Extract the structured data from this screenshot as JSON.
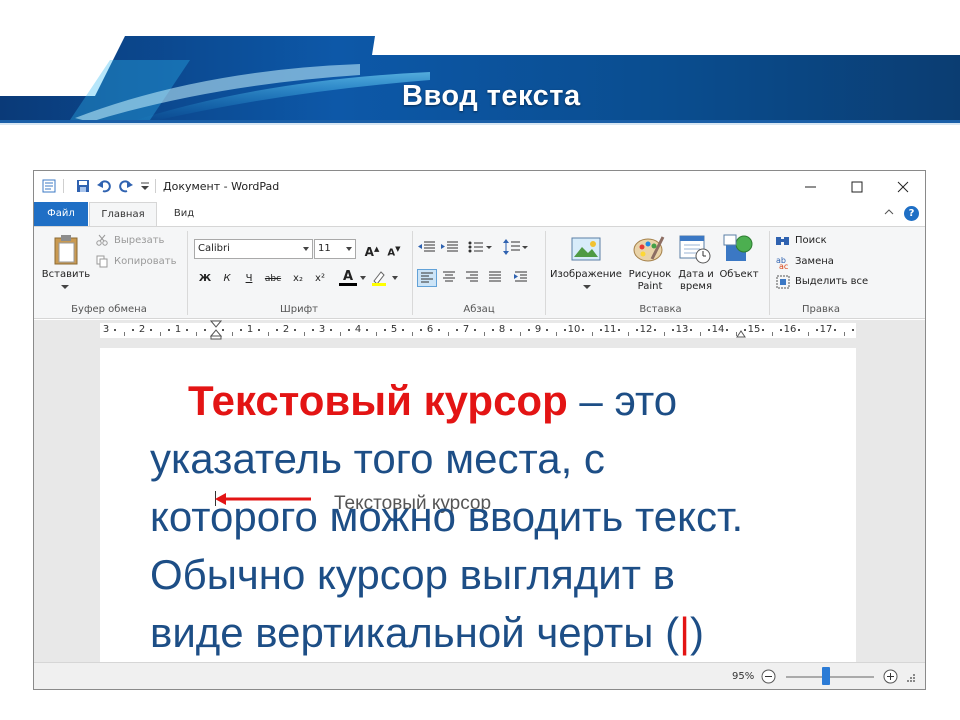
{
  "slide": {
    "title": "Ввод текста"
  },
  "window": {
    "title": "Документ - WordPad",
    "tabs": {
      "file": "Файл",
      "home": "Главная",
      "view": "Вид"
    },
    "help_glyph": "?"
  },
  "ribbon": {
    "clipboard": {
      "paste": "Вставить",
      "cut": "Вырезать",
      "copy": "Копировать",
      "group": "Буфер обмена"
    },
    "font": {
      "family": "Calibri",
      "size": "11",
      "grow_glyph": "A",
      "shrink_glyph": "A",
      "bold": "Ж",
      "italic": "К",
      "underline": "Ч",
      "strike": "abc",
      "subscript": "x₂",
      "superscript": "x²",
      "color_glyph": "A",
      "group": "Шрифт"
    },
    "paragraph": {
      "group": "Абзац"
    },
    "insert": {
      "image": "Изображение",
      "paint_line1": "Рисунок",
      "paint_line2": "Paint",
      "datetime_line1": "Дата и",
      "datetime_line2": "время",
      "object": "Объект",
      "group": "Вставка"
    },
    "editing": {
      "find": "Поиск",
      "replace": "Замена",
      "select_all": "Выделить все",
      "group": "Правка"
    }
  },
  "ruler": {
    "left_labels": [
      "3",
      "2",
      "1"
    ],
    "right_labels": [
      "1",
      "2",
      "3",
      "4",
      "5",
      "6",
      "7",
      "8",
      "9",
      "10",
      "11",
      "12",
      "13",
      "14",
      "15",
      "16",
      "17"
    ]
  },
  "document": {
    "cursor_label": "Текстовый курсор"
  },
  "statusbar": {
    "zoom": "95%",
    "zoom_fraction": 0.45
  },
  "body": {
    "term": "Текстовый курсор",
    "line1_rest": " – это",
    "line2": "указатель того места, с",
    "line3": "которого можно вводить текст.",
    "line4": "Обычно курсор выглядит в",
    "line5_pre": "виде вертикальной черты (",
    "line5_bar": "|",
    "line5_post": ")"
  },
  "colors": {
    "accent_blue": "#1f6fc5",
    "body_text": "#1d4e86",
    "highlight_red": "#e31414"
  }
}
